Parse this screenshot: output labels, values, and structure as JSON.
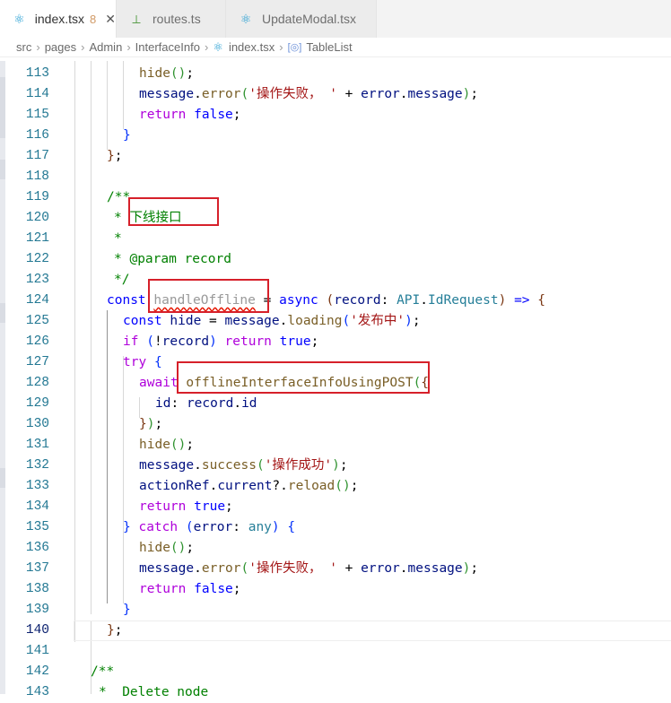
{
  "tabs": [
    {
      "label": "index.tsx",
      "badge": "8",
      "active": true,
      "icon": "react-icon"
    },
    {
      "label": "routes.ts",
      "badge": "",
      "active": false,
      "icon": "typescript-file-icon"
    },
    {
      "label": "UpdateModal.tsx",
      "badge": "",
      "active": false,
      "icon": "react-icon"
    }
  ],
  "breadcrumb": [
    "src",
    "pages",
    "Admin",
    "InterfaceInfo",
    "index.tsx",
    "TableList"
  ],
  "editor": {
    "current_line": 140,
    "lines": [
      {
        "n": 113,
        "tokens": [
          [
            "hide",
            "fn"
          ],
          [
            "(",
            "p1"
          ],
          [
            ")",
            "p1"
          ],
          [
            ";",
            "p"
          ]
        ]
      },
      {
        "n": 114,
        "tokens": [
          [
            "message",
            "var"
          ],
          [
            ".",
            "p"
          ],
          [
            "error",
            "fn"
          ],
          [
            "(",
            "p1"
          ],
          [
            "'操作失败， '",
            "str"
          ],
          [
            " + ",
            "p"
          ],
          [
            "error",
            "var"
          ],
          [
            ".",
            "p"
          ],
          [
            "message",
            "var"
          ],
          [
            ")",
            "p1"
          ],
          [
            ";",
            "p"
          ]
        ]
      },
      {
        "n": 115,
        "tokens": [
          [
            "return",
            "ctrl"
          ],
          [
            " ",
            "p"
          ],
          [
            "false",
            "kw"
          ],
          [
            ";",
            "p"
          ]
        ]
      },
      {
        "n": 116,
        "tokens": [
          [
            "}",
            "p3"
          ]
        ]
      },
      {
        "n": 117,
        "tokens": [
          [
            "}",
            "p2"
          ],
          [
            ";",
            "p"
          ]
        ]
      },
      {
        "n": 118,
        "tokens": []
      },
      {
        "n": 119,
        "tokens": [
          [
            "/**",
            "com"
          ]
        ]
      },
      {
        "n": 120,
        "tokens": [
          [
            "* 下线接口",
            "com"
          ]
        ]
      },
      {
        "n": 121,
        "tokens": [
          [
            "*",
            "com"
          ]
        ]
      },
      {
        "n": 122,
        "tokens": [
          [
            "* @param record",
            "com"
          ]
        ]
      },
      {
        "n": 123,
        "tokens": [
          [
            "*/",
            "com"
          ]
        ]
      },
      {
        "n": 124,
        "tokens": [
          [
            "const",
            "kw"
          ],
          [
            " ",
            "p"
          ],
          [
            "handleOffline",
            "dim"
          ],
          [
            " = ",
            "p"
          ],
          [
            "async",
            "kw"
          ],
          [
            " ",
            "p"
          ],
          [
            "(",
            "p2"
          ],
          [
            "record",
            "var"
          ],
          [
            ": ",
            "p"
          ],
          [
            "API",
            "type"
          ],
          [
            ".",
            "p"
          ],
          [
            "IdRequest",
            "type"
          ],
          [
            ")",
            "p2"
          ],
          [
            " ",
            "p"
          ],
          [
            "=>",
            "kw"
          ],
          [
            " ",
            "p"
          ],
          [
            "{",
            "p2"
          ]
        ]
      },
      {
        "n": 125,
        "tokens": [
          [
            "const",
            "kw"
          ],
          [
            " ",
            "p"
          ],
          [
            "hide",
            "var"
          ],
          [
            " = ",
            "p"
          ],
          [
            "message",
            "var"
          ],
          [
            ".",
            "p"
          ],
          [
            "loading",
            "fn"
          ],
          [
            "(",
            "p3"
          ],
          [
            "'发布中'",
            "str"
          ],
          [
            ")",
            "p3"
          ],
          [
            ";",
            "p"
          ]
        ]
      },
      {
        "n": 126,
        "tokens": [
          [
            "if",
            "ctrl"
          ],
          [
            " ",
            "p"
          ],
          [
            "(",
            "p3"
          ],
          [
            "!",
            "p"
          ],
          [
            "record",
            "var"
          ],
          [
            ")",
            "p3"
          ],
          [
            " ",
            "p"
          ],
          [
            "return",
            "ctrl"
          ],
          [
            " ",
            "p"
          ],
          [
            "true",
            "kw"
          ],
          [
            ";",
            "p"
          ]
        ]
      },
      {
        "n": 127,
        "tokens": [
          [
            "try",
            "ctrl"
          ],
          [
            " ",
            "p"
          ],
          [
            "{",
            "p3"
          ]
        ]
      },
      {
        "n": 128,
        "tokens": [
          [
            "await",
            "ctrl"
          ],
          [
            " ",
            "p"
          ],
          [
            "offlineInterfaceInfoUsingPOST",
            "fn"
          ],
          [
            "(",
            "p1"
          ],
          [
            "{",
            "p2"
          ]
        ]
      },
      {
        "n": 129,
        "tokens": [
          [
            "id",
            "var"
          ],
          [
            ": ",
            "p"
          ],
          [
            "record",
            "var"
          ],
          [
            ".",
            "p"
          ],
          [
            "id",
            "var"
          ]
        ]
      },
      {
        "n": 130,
        "tokens": [
          [
            "}",
            "p2"
          ],
          [
            ")",
            "p1"
          ],
          [
            ";",
            "p"
          ]
        ]
      },
      {
        "n": 131,
        "tokens": [
          [
            "hide",
            "fn"
          ],
          [
            "(",
            "p1"
          ],
          [
            ")",
            "p1"
          ],
          [
            ";",
            "p"
          ]
        ]
      },
      {
        "n": 132,
        "tokens": [
          [
            "message",
            "var"
          ],
          [
            ".",
            "p"
          ],
          [
            "success",
            "fn"
          ],
          [
            "(",
            "p1"
          ],
          [
            "'操作成功'",
            "str"
          ],
          [
            ")",
            "p1"
          ],
          [
            ";",
            "p"
          ]
        ]
      },
      {
        "n": 133,
        "tokens": [
          [
            "actionRef",
            "var"
          ],
          [
            ".",
            "p"
          ],
          [
            "current",
            "var"
          ],
          [
            "?.",
            "p"
          ],
          [
            "reload",
            "fn"
          ],
          [
            "(",
            "p1"
          ],
          [
            ")",
            "p1"
          ],
          [
            ";",
            "p"
          ]
        ]
      },
      {
        "n": 134,
        "tokens": [
          [
            "return",
            "ctrl"
          ],
          [
            " ",
            "p"
          ],
          [
            "true",
            "kw"
          ],
          [
            ";",
            "p"
          ]
        ]
      },
      {
        "n": 135,
        "tokens": [
          [
            "}",
            "p3"
          ],
          [
            " ",
            "p"
          ],
          [
            "catch",
            "ctrl"
          ],
          [
            " ",
            "p"
          ],
          [
            "(",
            "p3"
          ],
          [
            "error",
            "var"
          ],
          [
            ": ",
            "p"
          ],
          [
            "any",
            "type"
          ],
          [
            ")",
            "p3"
          ],
          [
            " ",
            "p"
          ],
          [
            "{",
            "p3"
          ]
        ]
      },
      {
        "n": 136,
        "tokens": [
          [
            "hide",
            "fn"
          ],
          [
            "(",
            "p1"
          ],
          [
            ")",
            "p1"
          ],
          [
            ";",
            "p"
          ]
        ]
      },
      {
        "n": 137,
        "tokens": [
          [
            "message",
            "var"
          ],
          [
            ".",
            "p"
          ],
          [
            "error",
            "fn"
          ],
          [
            "(",
            "p1"
          ],
          [
            "'操作失败， '",
            "str"
          ],
          [
            " + ",
            "p"
          ],
          [
            "error",
            "var"
          ],
          [
            ".",
            "p"
          ],
          [
            "message",
            "var"
          ],
          [
            ")",
            "p1"
          ],
          [
            ";",
            "p"
          ]
        ]
      },
      {
        "n": 138,
        "tokens": [
          [
            "return",
            "ctrl"
          ],
          [
            " ",
            "p"
          ],
          [
            "false",
            "kw"
          ],
          [
            ";",
            "p"
          ]
        ]
      },
      {
        "n": 139,
        "tokens": [
          [
            "}",
            "p3"
          ]
        ]
      },
      {
        "n": 140,
        "tokens": [
          [
            "}",
            "p2"
          ],
          [
            ";",
            "p"
          ]
        ]
      },
      {
        "n": 141,
        "tokens": []
      },
      {
        "n": 142,
        "tokens": [
          [
            "/**",
            "com"
          ]
        ]
      },
      {
        "n": 143,
        "tokens": [
          [
            "*  Delete node",
            "com"
          ]
        ]
      }
    ]
  }
}
